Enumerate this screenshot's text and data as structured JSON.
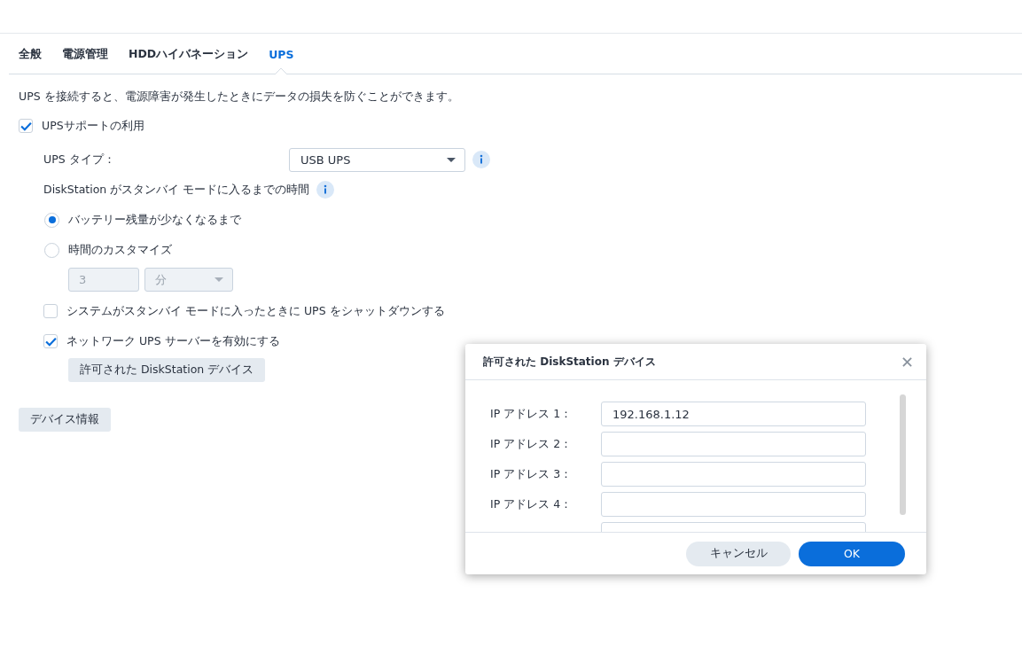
{
  "tabs": [
    {
      "label": "全般",
      "selected": false
    },
    {
      "label": "電源管理",
      "selected": false
    },
    {
      "label": "HDDハイバネーション",
      "selected": false
    },
    {
      "label": "UPS",
      "selected": true
    }
  ],
  "description": "UPS を接続すると、電源障害が発生したときにデータの損失を防ぐことができます。",
  "ups_support": {
    "label": "UPSサポートの利用",
    "checked": true
  },
  "ups_type": {
    "label": "UPS タイプ：",
    "value": "USB UPS"
  },
  "standby_time": {
    "label": "DiskStation がスタンバイ モードに入るまでの時間"
  },
  "standby_options": [
    {
      "label": "バッテリー残量が少なくなるまで",
      "selected": true
    },
    {
      "label": "時間のカスタマイズ",
      "selected": false
    }
  ],
  "custom_time": {
    "value": "3",
    "unit": "分",
    "disabled": true
  },
  "options": [
    {
      "label": "システムがスタンバイ モードに入ったときに UPS をシャットダウンする",
      "checked": false
    },
    {
      "label": "ネットワーク UPS サーバーを有効にする",
      "checked": true
    }
  ],
  "allowed_devices_button": "許可された DiskStation デバイス",
  "device_info_button": "デバイス情報",
  "dialog": {
    "title": "許可された DiskStation デバイス",
    "fields": [
      {
        "label": "IP アドレス 1：",
        "value": "192.168.1.12"
      },
      {
        "label": "IP アドレス 2："
      },
      {
        "label": "IP アドレス 3："
      },
      {
        "label": "IP アドレス 4："
      }
    ],
    "more_fields_below": true,
    "buttons": [
      {
        "label": "キャンセル",
        "kind": "secondary"
      },
      {
        "label": "OK",
        "kind": "primary"
      }
    ]
  }
}
